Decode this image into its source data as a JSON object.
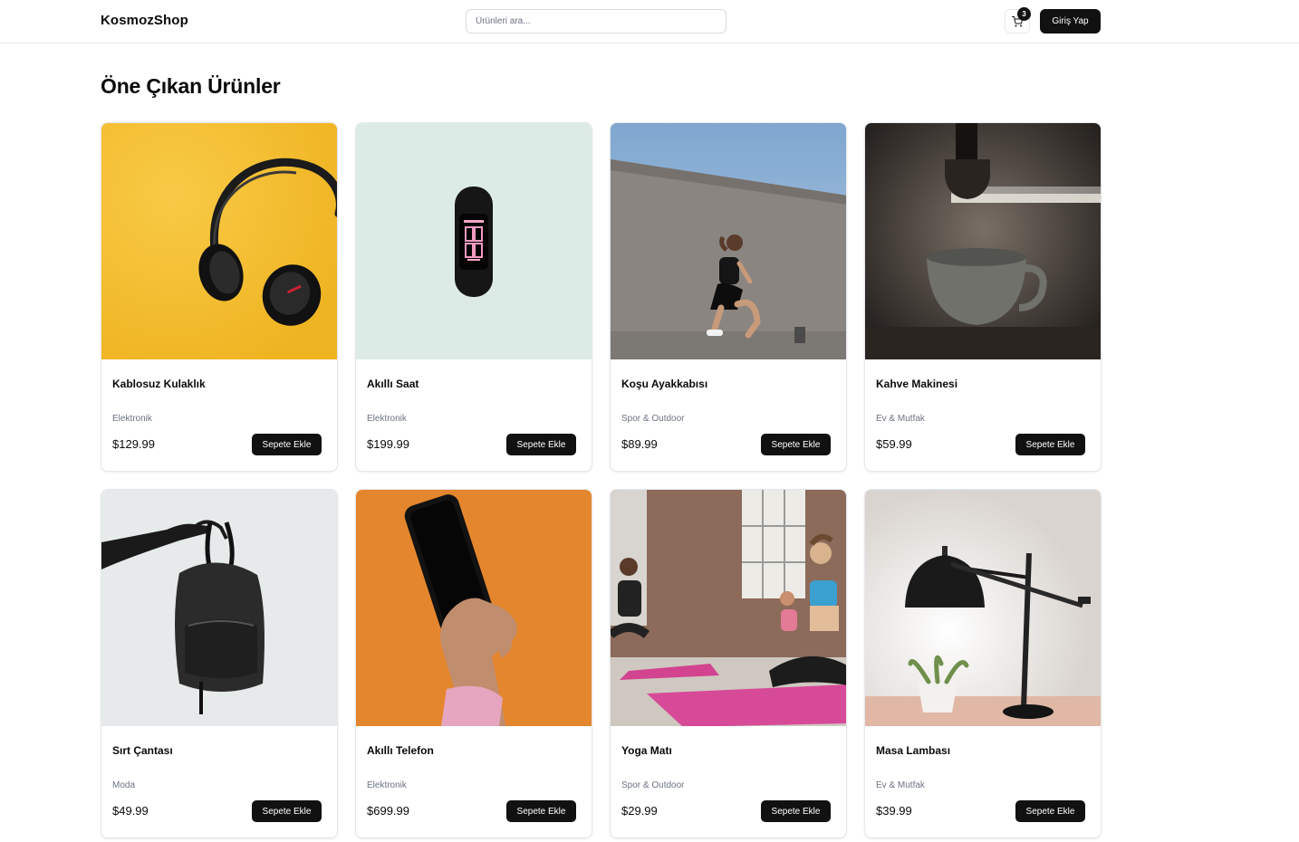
{
  "header": {
    "logo": "KosmozShop",
    "search_placeholder": "Ürünleri ara...",
    "cart_count": "3",
    "login_label": "Giriş Yap"
  },
  "main": {
    "title": "Öne Çıkan Ürünler",
    "products": [
      {
        "name": "Kablosuz Kulaklık",
        "category": "Elektronik",
        "price": "$129.99",
        "button": "Sepete Ekle"
      },
      {
        "name": "Akıllı Saat",
        "category": "Elektronik",
        "price": "$199.99",
        "button": "Sepete Ekle"
      },
      {
        "name": "Koşu Ayakkabısı",
        "category": "Spor & Outdoor",
        "price": "$89.99",
        "button": "Sepete Ekle"
      },
      {
        "name": "Kahve Makinesi",
        "category": "Ev & Mutfak",
        "price": "$59.99",
        "button": "Sepete Ekle"
      },
      {
        "name": "Sırt Çantası",
        "category": "Moda",
        "price": "$49.99",
        "button": "Sepete Ekle"
      },
      {
        "name": "Akıllı Telefon",
        "category": "Elektronik",
        "price": "$699.99",
        "button": "Sepete Ekle"
      },
      {
        "name": "Yoga Matı",
        "category": "Spor & Outdoor",
        "price": "$29.99",
        "button": "Sepete Ekle"
      },
      {
        "name": "Masa Lambası",
        "category": "Ev & Mutfak",
        "price": "$39.99",
        "button": "Sepete Ekle"
      }
    ]
  },
  "colors": {
    "primary": "#111111",
    "border": "#e5e7eb",
    "muted_text": "#6b7280"
  }
}
